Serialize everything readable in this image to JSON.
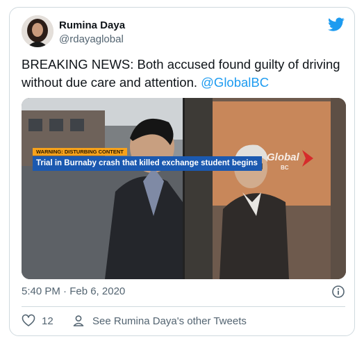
{
  "author": {
    "name": "Rumina Daya",
    "handle": "@rdayaglobal"
  },
  "tweet": {
    "text_before": "BREAKING NEWS: Both accused found guilty of driving without due care and attention. ",
    "mention": "@GlobalBC"
  },
  "media": {
    "warning_label": "WARNING: DISTURBING CONTENT",
    "headline": "Trial in Burnaby crash that killed exchange student begins",
    "brand": "Global",
    "brand_sub": "BC"
  },
  "meta": {
    "timestamp": "5:40 PM · Feb 6, 2020"
  },
  "actions": {
    "like_count": "12",
    "other_tweets_label": "See Rumina Daya's other Tweets"
  },
  "colors": {
    "accent": "#1d9bf0",
    "secondary_text": "#536471",
    "border": "#cfd9de",
    "lower_third": "#1b59b0",
    "warning": "#f7a21b"
  },
  "icons": [
    "twitter-bird-icon",
    "info-icon",
    "heart-icon",
    "person-icon"
  ]
}
